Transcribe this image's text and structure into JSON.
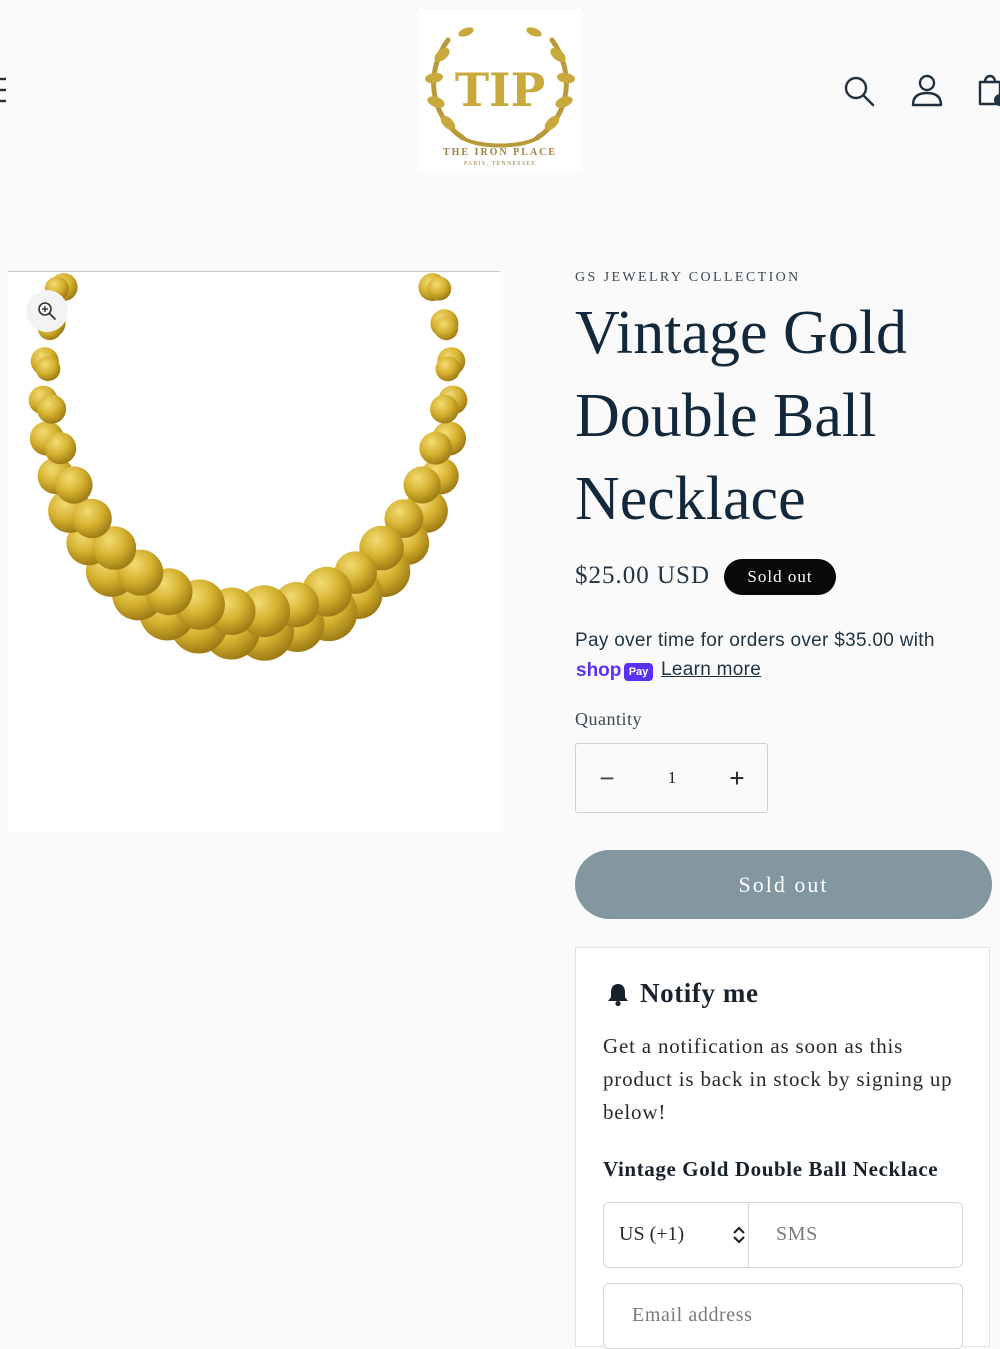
{
  "header": {
    "logo": {
      "monogram": "TIP",
      "name": "THE IRON PLACE",
      "location": "PARIS, TENNESSEE"
    },
    "icons": [
      "menu-icon",
      "search-icon",
      "account-icon",
      "cart-icon"
    ]
  },
  "product": {
    "vendor": "GS JEWELRY COLLECTION",
    "title": "Vintage Gold Double Ball Necklace",
    "price": "$25.00 USD",
    "badge": "Sold out",
    "installments": {
      "text": "Pay over time for orders over $35.00 with",
      "shop_label": "shop",
      "pay_label": "Pay",
      "learn_more": "Learn more"
    },
    "quantity": {
      "label": "Quantity",
      "minus": "−",
      "value": "1",
      "plus": "+"
    },
    "button_label": "Sold out"
  },
  "notify": {
    "title": "Notify me",
    "description": "Get a notification as soon as this product is back in stock by signing up below!",
    "product_name": "Vintage Gold Double Ball Necklace",
    "country_value": "US (+1)",
    "sms_placeholder": "SMS",
    "email_placeholder": "Email address"
  },
  "colors": {
    "gold": "#d4b02e",
    "button": "#82979f",
    "badge": "#090909",
    "shop_pay": "#5a31f4"
  }
}
